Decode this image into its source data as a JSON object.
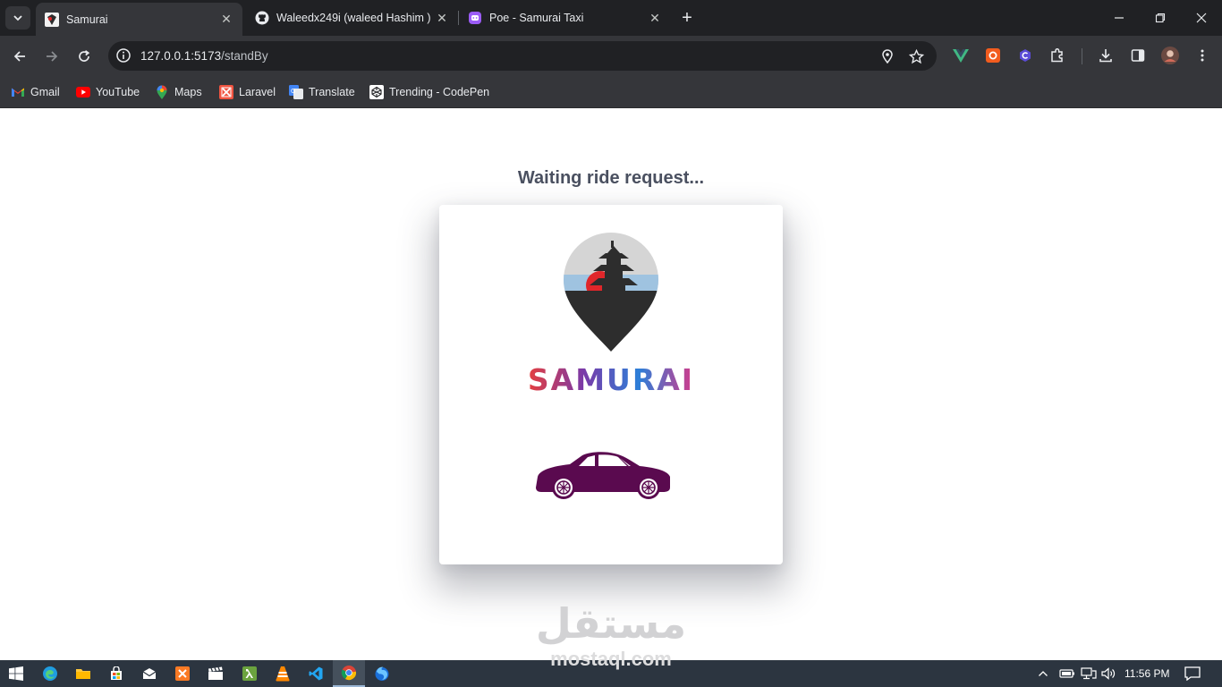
{
  "tabs": [
    {
      "title": "Samurai",
      "active": true
    },
    {
      "title": "Waleedx249i (waleed Hashim )",
      "active": false
    },
    {
      "title": "Poe - Samurai Taxi",
      "active": false
    }
  ],
  "address": {
    "host": "127.0.0.1:5173",
    "path": "/standBy"
  },
  "bookmarks": [
    {
      "label": "Gmail",
      "icon": "gmail-icon"
    },
    {
      "label": "YouTube",
      "icon": "youtube-icon"
    },
    {
      "label": "Maps",
      "icon": "maps-icon"
    },
    {
      "label": "Laravel",
      "icon": "laravel-icon"
    },
    {
      "label": "Translate",
      "icon": "translate-icon"
    },
    {
      "label": "Trending - CodePen",
      "icon": "codepen-icon"
    }
  ],
  "page": {
    "heading": "Waiting ride request...",
    "brand": "SAMURAI"
  },
  "watermark": {
    "arabic": "مستقل",
    "latin": "mostaql.com"
  },
  "taskbar": {
    "time": "11:56 PM"
  },
  "colors": {
    "car": "#5a0a4f",
    "sun": "#e0262a",
    "pin_dark": "#2d2d2d",
    "pin_light": "#d5d5d5",
    "brand_gradient": [
      "#e53f3f",
      "#7a3aa8",
      "#2d7fd8",
      "#d33a8a"
    ]
  }
}
